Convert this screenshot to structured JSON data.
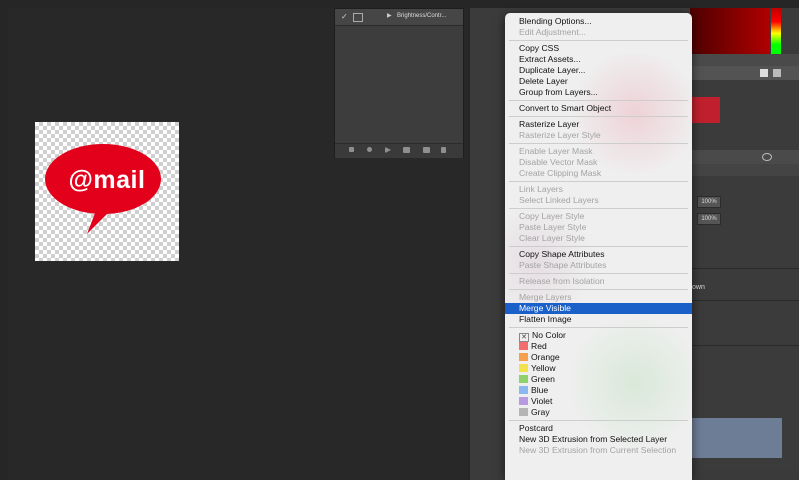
{
  "document": {
    "logo_text": "@mail",
    "logo_color": "#e3001b"
  },
  "history_panel": {
    "row_label": "Brightness/Contr..."
  },
  "layers_panel": {
    "opacity_value": "100%",
    "fill_value": "100%",
    "partial_text": "own"
  },
  "context_menu": {
    "groups": [
      [
        {
          "label": "Blending Options...",
          "enabled": true
        },
        {
          "label": "Edit Adjustment...",
          "enabled": false
        }
      ],
      [
        {
          "label": "Copy CSS",
          "enabled": true
        },
        {
          "label": "Extract Assets...",
          "enabled": true
        },
        {
          "label": "Duplicate Layer...",
          "enabled": true
        },
        {
          "label": "Delete Layer",
          "enabled": true
        },
        {
          "label": "Group from Layers...",
          "enabled": true
        }
      ],
      [
        {
          "label": "Convert to Smart Object",
          "enabled": true
        }
      ],
      [
        {
          "label": "Rasterize Layer",
          "enabled": true
        },
        {
          "label": "Rasterize Layer Style",
          "enabled": false
        }
      ],
      [
        {
          "label": "Enable Layer Mask",
          "enabled": false
        },
        {
          "label": "Disable Vector Mask",
          "enabled": false
        },
        {
          "label": "Create Clipping Mask",
          "enabled": false
        }
      ],
      [
        {
          "label": "Link Layers",
          "enabled": false
        },
        {
          "label": "Select Linked Layers",
          "enabled": false
        }
      ],
      [
        {
          "label": "Copy Layer Style",
          "enabled": false
        },
        {
          "label": "Paste Layer Style",
          "enabled": false
        },
        {
          "label": "Clear Layer Style",
          "enabled": false
        }
      ],
      [
        {
          "label": "Copy Shape Attributes",
          "enabled": true
        },
        {
          "label": "Paste Shape Attributes",
          "enabled": false
        }
      ],
      [
        {
          "label": "Release from Isolation",
          "enabled": false
        }
      ],
      [
        {
          "label": "Merge Layers",
          "enabled": false
        },
        {
          "label": "Merge Visible",
          "enabled": true,
          "selected": true
        },
        {
          "label": "Flatten Image",
          "enabled": true
        }
      ],
      [
        {
          "label": "No Color",
          "enabled": true,
          "color": "none"
        },
        {
          "label": "Red",
          "enabled": true,
          "color": "#f36d6d"
        },
        {
          "label": "Orange",
          "enabled": true,
          "color": "#f6a04d"
        },
        {
          "label": "Yellow",
          "enabled": true,
          "color": "#f2e14c"
        },
        {
          "label": "Green",
          "enabled": true,
          "color": "#8fd16a"
        },
        {
          "label": "Blue",
          "enabled": true,
          "color": "#8ab7f0"
        },
        {
          "label": "Violet",
          "enabled": true,
          "color": "#b89ae0"
        },
        {
          "label": "Gray",
          "enabled": true,
          "color": "#b5b5b5"
        }
      ],
      [
        {
          "label": "Postcard",
          "enabled": true
        },
        {
          "label": "New 3D Extrusion from Selected Layer",
          "enabled": true
        },
        {
          "label": "New 3D Extrusion from Current Selection",
          "enabled": false
        }
      ]
    ]
  }
}
